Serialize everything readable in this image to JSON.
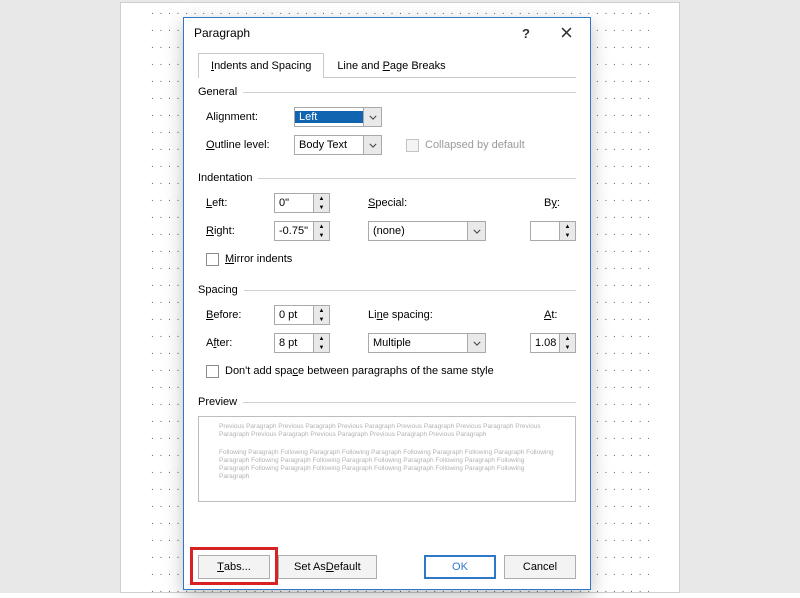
{
  "dialog": {
    "title": "Paragraph",
    "help": "?",
    "tabs": {
      "indents": "Indents and Spacing",
      "pagebreaks": "Line and Page Breaks"
    },
    "general": {
      "header": "General",
      "alignment_label": "Alignment:",
      "alignment_value": "Left",
      "outline_label": "Outline level:",
      "outline_value": "Body Text",
      "collapsed_label": "Collapsed by default"
    },
    "indentation": {
      "header": "Indentation",
      "left_label": "Left:",
      "left_value": "0\"",
      "right_label": "Right:",
      "right_value": "-0.75\"",
      "special_label": "Special:",
      "special_value": "(none)",
      "by_label": "By:",
      "by_value": "",
      "mirror_label": "Mirror indents"
    },
    "spacing": {
      "header": "Spacing",
      "before_label": "Before:",
      "before_value": "0 pt",
      "after_label": "After:",
      "after_value": "8 pt",
      "linespacing_label": "Line spacing:",
      "linespacing_value": "Multiple",
      "at_label": "At:",
      "at_value": "1.08",
      "dontadd_label": "Don't add space between paragraphs of the same style"
    },
    "preview": {
      "header": "Preview",
      "prev_line": "Previous Paragraph Previous Paragraph Previous Paragraph Previous Paragraph Previous Paragraph Previous Paragraph Previous Paragraph Previous Paragraph Previous Paragraph Previous Paragraph",
      "next_line": "Following Paragraph Following Paragraph Following Paragraph Following Paragraph Following Paragraph Following Paragraph Following Paragraph Following Paragraph Following Paragraph Following Paragraph Following Paragraph Following Paragraph Following Paragraph Following Paragraph Following Paragraph Following Paragraph"
    },
    "buttons": {
      "tabs": "Tabs...",
      "default": "Set As Default",
      "ok": "OK",
      "cancel": "Cancel"
    }
  }
}
